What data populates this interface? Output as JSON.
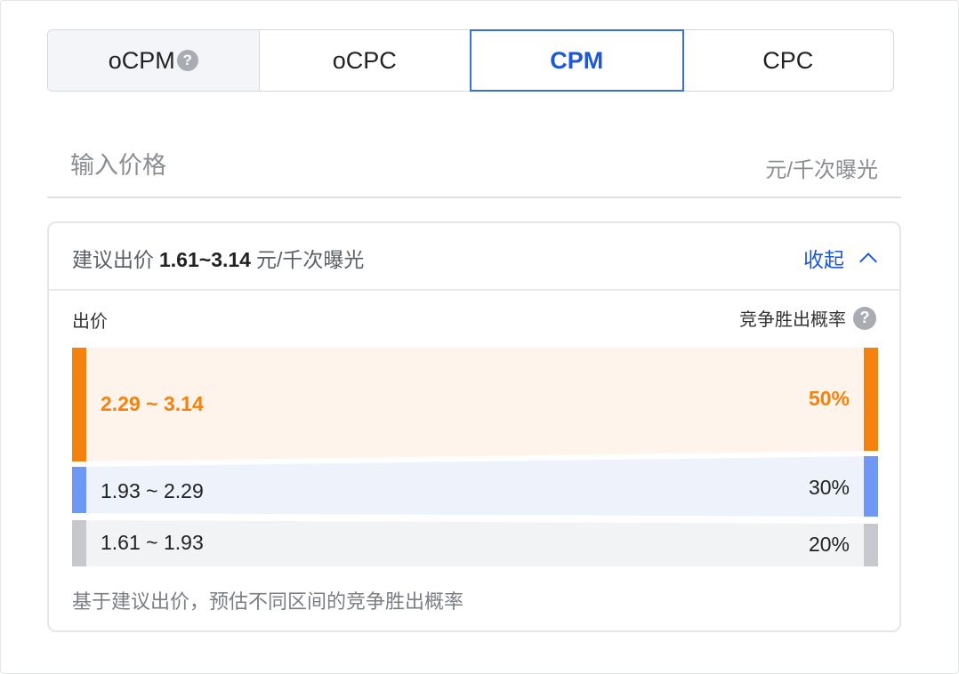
{
  "tabs": [
    {
      "label": "oCPM",
      "has_help": true,
      "help_glyph": "?"
    },
    {
      "label": "oCPC"
    },
    {
      "label": "CPM",
      "active": true
    },
    {
      "label": "CPC"
    }
  ],
  "price": {
    "placeholder": "输入价格",
    "value": "",
    "unit": "元/千次曝光"
  },
  "suggestion": {
    "prefix": "建议出价",
    "range": "1.61~3.14",
    "unit": "元/千次曝光",
    "collapse_label": "收起",
    "col_left": "出价",
    "col_right": "竞争胜出概率",
    "help_glyph": "?",
    "bands": [
      {
        "range": "2.29 ~ 3.14",
        "percent": "50%",
        "color": "#f5820f",
        "bg": "#fff4ec",
        "text_color": "#f5820f"
      },
      {
        "range": "1.93 ~ 2.29",
        "percent": "30%",
        "color": "#6f97f6",
        "bg": "#eef2fa",
        "text_color": "#222222"
      },
      {
        "range": "1.61 ~ 1.93",
        "percent": "20%",
        "color": "#c6c8cd",
        "bg": "#f2f3f5",
        "text_color": "#222222"
      }
    ],
    "footnote": "基于建议出价，预估不同区间的竞争胜出概率"
  },
  "colors": {
    "accent": "#1f57d6",
    "active_border": "#3a6ee8"
  },
  "icons": {
    "help": "question-circle-icon",
    "collapse": "chevron-up-icon"
  }
}
